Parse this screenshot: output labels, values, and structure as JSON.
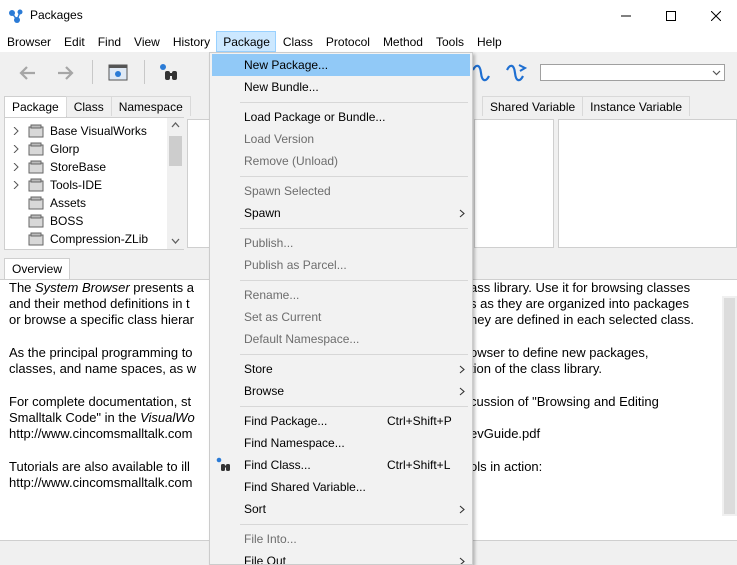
{
  "window": {
    "title": "Packages"
  },
  "menubar": [
    {
      "label": "Browser"
    },
    {
      "label": "Edit"
    },
    {
      "label": "Find"
    },
    {
      "label": "View"
    },
    {
      "label": "History"
    },
    {
      "label": "Package"
    },
    {
      "label": "Class"
    },
    {
      "label": "Protocol"
    },
    {
      "label": "Method"
    },
    {
      "label": "Tools"
    },
    {
      "label": "Help"
    }
  ],
  "tabs_left": [
    {
      "label": "Package"
    },
    {
      "label": "Class"
    },
    {
      "label": "Namespace"
    }
  ],
  "tabs_right": [
    {
      "label": "Shared Variable"
    },
    {
      "label": "Instance Variable"
    }
  ],
  "tree": [
    {
      "label": "Base VisualWorks",
      "expandable": true
    },
    {
      "label": "Glorp",
      "expandable": true
    },
    {
      "label": "StoreBase",
      "expandable": true
    },
    {
      "label": "Tools-IDE",
      "expandable": true
    },
    {
      "label": "Assets",
      "expandable": false
    },
    {
      "label": "BOSS",
      "expandable": false
    },
    {
      "label": "Compression-ZLib",
      "expandable": false
    }
  ],
  "overview": {
    "tab_label": "Overview",
    "line1_a": "The ",
    "line1_b": "System Browser",
    "line1_c": " presents a",
    "line1_d": "ass library. Use it for browsing classes",
    "line2_a": "and their method definitions in t",
    "line2_b": "s as they are organized into packages",
    "line3_a": "or browse a specific class hierar",
    "line3_b": "hey are defined in each selected class.",
    "line4_a": "As the principal programming to",
    "line4_b": "owser to define new packages,",
    "line5_a": "classes, and name spaces, as w",
    "line5_b": "tion of the class library.",
    "line6_a": "For complete documentation, st",
    "line6_b": "cussion of \"Browsing and Editing",
    "line7_a": "Smalltalk Code\" in the ",
    "line7_b": "VisualWo",
    "line8_a": "http://www.cincomsmalltalk.com",
    "line8_b": "evGuide.pdf",
    "line9_a": "Tutorials are also available to ill",
    "line9_b": "ols in action:",
    "line10_a": "http://www.cincomsmalltalk.com"
  },
  "package_menu": {
    "items": [
      {
        "label": "New Package...",
        "highlighted": true
      },
      {
        "label": "New Bundle..."
      },
      {
        "label": "Load Package or Bundle..."
      },
      {
        "label": "Load Version",
        "disabled": true
      },
      {
        "label": "Remove (Unload)",
        "disabled": true
      },
      {
        "label": "Spawn Selected",
        "disabled": true
      },
      {
        "label": "Spawn",
        "submenu": true
      },
      {
        "label": "Publish...",
        "disabled": true
      },
      {
        "label": "Publish as Parcel...",
        "disabled": true
      },
      {
        "label": "Rename...",
        "disabled": true
      },
      {
        "label": "Set as Current",
        "disabled": true
      },
      {
        "label": "Default Namespace...",
        "disabled": true
      },
      {
        "label": "Store",
        "submenu": true
      },
      {
        "label": "Browse",
        "submenu": true
      },
      {
        "label": "Find Package...",
        "shortcut": "Ctrl+Shift+P"
      },
      {
        "label": "Find Namespace..."
      },
      {
        "label": "Find Class...",
        "shortcut": "Ctrl+Shift+L",
        "icon": "binoculars-icon"
      },
      {
        "label": "Find Shared Variable..."
      },
      {
        "label": "Sort",
        "submenu": true
      },
      {
        "label": "File Into...",
        "disabled": true
      },
      {
        "label": "File Out",
        "submenu": true
      }
    ]
  },
  "colors": {
    "highlight": "#91c9f7",
    "menu_active": "#cce8ff",
    "disabled_text": "#6d6d6d"
  }
}
